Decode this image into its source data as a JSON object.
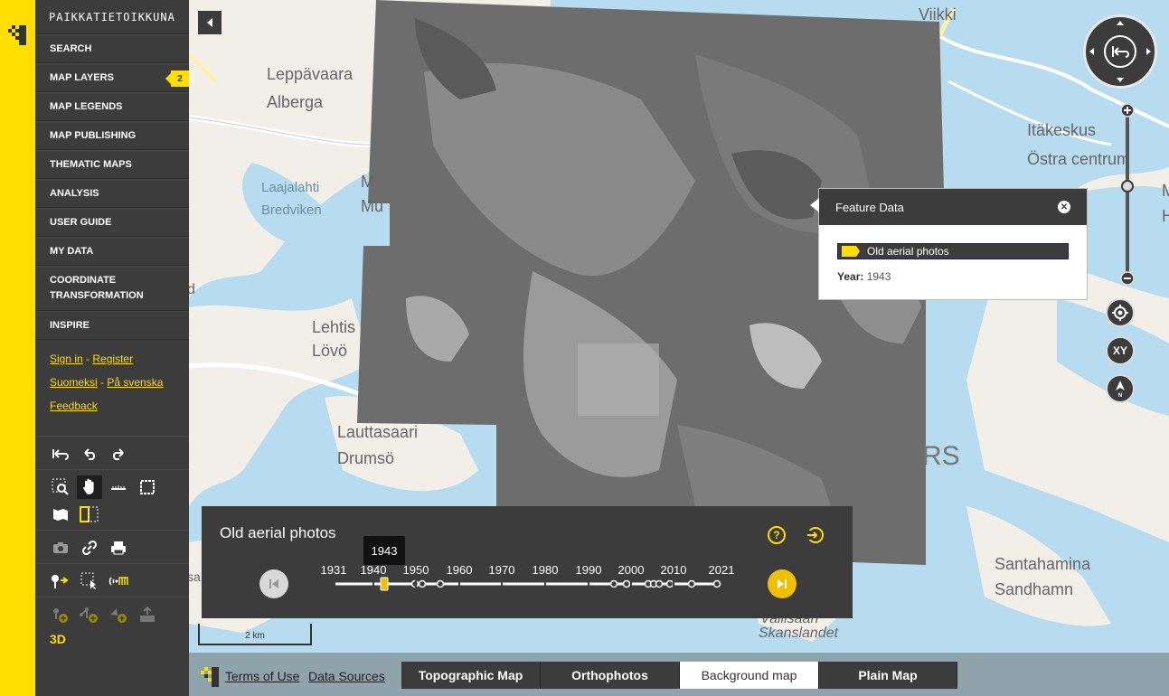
{
  "brand": "PAIKKATIETOIKKUNA",
  "colors": {
    "accent": "#ffde00",
    "panel": "#3c3c3c",
    "water": "#b8dcef",
    "land": "#f2efe9"
  },
  "menu": [
    {
      "id": "search",
      "label": "SEARCH"
    },
    {
      "id": "map-layers",
      "label": "MAP LAYERS",
      "badge": "2"
    },
    {
      "id": "map-legends",
      "label": "MAP LEGENDS"
    },
    {
      "id": "map-publishing",
      "label": "MAP PUBLISHING"
    },
    {
      "id": "thematic-maps",
      "label": "THEMATIC MAPS"
    },
    {
      "id": "analysis",
      "label": "ANALYSIS"
    },
    {
      "id": "user-guide",
      "label": "USER GUIDE"
    },
    {
      "id": "my-data",
      "label": "MY DATA"
    },
    {
      "id": "coordinate-transformation",
      "label": "COORDINATE TRANSFORMATION"
    },
    {
      "id": "inspire",
      "label": "INSPIRE"
    }
  ],
  "account": {
    "sign_in": "Sign in",
    "register": "Register",
    "sep": "-"
  },
  "language": {
    "fi": "Suomeksi",
    "sv": "På svenska",
    "sep": "-"
  },
  "feedback": "Feedback",
  "tools_3d": "3D",
  "map_labels": {
    "viikki": "Viikki",
    "leppavaara": "Leppävaara",
    "alberga": "Alberga",
    "laajalahti": "Laajalahti",
    "bredviken": "Bredviken",
    "m1": "M",
    "mu": "Mu",
    "lehtis": "Lehtis",
    "lovo": "Lövö",
    "lauttasaari": "Lauttasaari",
    "drumso": "Drumsö",
    "itakeskus": "Itäkeskus",
    "ostra_centrum": "Östra centrum",
    "m2": "M",
    "h": "H",
    "rs": "RS",
    "santahamina": "Santahamina",
    "sandhamn": "Sandhamn",
    "vallisaari": "Vallisaari",
    "skanslandet": "Skanslandet",
    "d": "d",
    "sa": "sa"
  },
  "popup": {
    "title": "Feature Data",
    "layer": "Old aerial photos",
    "year_label": "Year:",
    "year_value": "1943"
  },
  "timeline": {
    "title": "Old aerial photos",
    "selected": "1943",
    "years": [
      "1931",
      "1940",
      "1950",
      "1960",
      "1970",
      "1980",
      "1990",
      "2000",
      "2010",
      "2021"
    ]
  },
  "scale": "2 km",
  "zoom_label": "XY",
  "bottom": {
    "terms": "Terms of Use",
    "sources": "Data Sources",
    "buttons": [
      "Topographic Map",
      "Orthophotos",
      "Background map",
      "Plain Map"
    ],
    "selected": "Background map"
  }
}
